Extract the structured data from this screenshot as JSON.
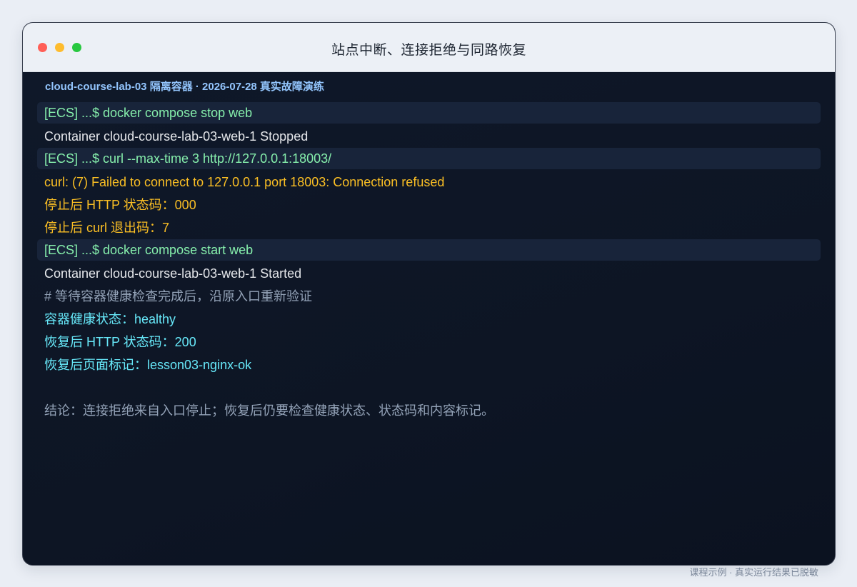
{
  "window": {
    "title": "站点中断、连接拒绝与同路恢复",
    "controls": {
      "close_color": "#ff5f57",
      "minimize_color": "#febc2e",
      "zoom_color": "#28c840"
    }
  },
  "terminal": {
    "subtitle": "cloud-course-lab-03 隔离容器 · 2026-07-28 真实故障演练",
    "lines": [
      {
        "kind": "cmd",
        "text": "[ECS] ...$ docker compose stop web",
        "color": "#86efac"
      },
      {
        "kind": "out",
        "text": "Container cloud-course-lab-03-web-1 Stopped",
        "color": "#e5e7eb"
      },
      {
        "kind": "cmd",
        "text": "[ECS] ...$ curl --max-time 3 http://127.0.0.1:18003/",
        "color": "#86efac"
      },
      {
        "kind": "warn",
        "text": "curl: (7) Failed to connect to 127.0.0.1 port 18003: Connection refused",
        "color": "#fbbf24"
      },
      {
        "kind": "warn",
        "text": "停止后 HTTP 状态码：000",
        "color": "#fbbf24"
      },
      {
        "kind": "warn",
        "text": "停止后 curl 退出码：7",
        "color": "#fbbf24"
      },
      {
        "kind": "cmd",
        "text": "[ECS] ...$ docker compose start web",
        "color": "#86efac"
      },
      {
        "kind": "out",
        "text": "Container cloud-course-lab-03-web-1 Started",
        "color": "#e5e7eb"
      },
      {
        "kind": "comment",
        "text": "# 等待容器健康检查完成后，沿原入口重新验证",
        "color": "#94a3b8"
      },
      {
        "kind": "ok",
        "text": "容器健康状态：healthy",
        "color": "#67e8f9"
      },
      {
        "kind": "ok",
        "text": "恢复后 HTTP 状态码：200",
        "color": "#67e8f9"
      },
      {
        "kind": "ok",
        "text": "恢复后页面标记：lesson03-nginx-ok",
        "color": "#67e8f9"
      },
      {
        "kind": "spacer",
        "text": "",
        "color": ""
      },
      {
        "kind": "conclusion",
        "text": "结论：连接拒绝来自入口停止；恢复后仍要检查健康状态、状态码和内容标记。",
        "color": "#94a3b8"
      }
    ]
  },
  "footer": {
    "note": "课程示例 · 真实运行结果已脱敏"
  }
}
